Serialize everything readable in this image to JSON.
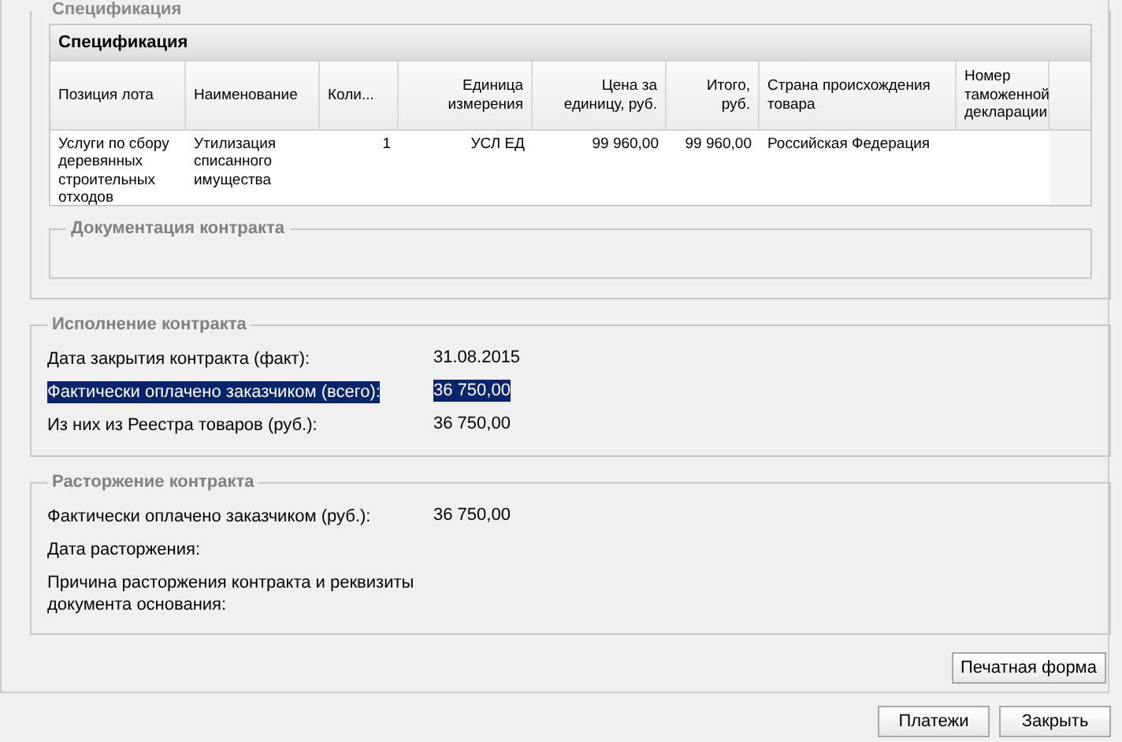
{
  "specification": {
    "legend": "Спецификация",
    "grid_title": "Спецификация",
    "columns": [
      "Позиция лота",
      "Наименование",
      "Коли...",
      "Единица измерения",
      "Цена за единицу, руб.",
      "Итого, руб.",
      "Страна происхождения товара",
      "Номер таможенной декларации"
    ],
    "rows": [
      [
        "Услуги по сбору деревянных строительных отходов",
        "Утилизация списанного имущества",
        "1",
        "УСЛ ЕД",
        "99 960,00",
        "99 960,00",
        "Российская Федерация",
        ""
      ]
    ]
  },
  "documentation": {
    "legend": "Документация контракта"
  },
  "execution": {
    "legend": "Исполнение контракта",
    "fields": [
      {
        "label": "Дата закрытия контракта (факт):",
        "value": "31.08.2015",
        "selected": false
      },
      {
        "label": "Фактически оплачено заказчиком (всего):",
        "value": "36 750,00",
        "selected": true
      },
      {
        "label": "Из них из Реестра товаров (руб.):",
        "value": "36 750,00",
        "selected": false
      }
    ]
  },
  "termination": {
    "legend": "Расторжение контракта",
    "fields": [
      {
        "label": "Фактически оплачено заказчиком (руб.):",
        "value": "36 750,00",
        "selected": false
      },
      {
        "label": "Дата расторжения:",
        "selected": false
      },
      {
        "label": "Причина расторжения контракта и реквизиты документа основания:",
        "selected": false
      }
    ]
  },
  "print_button": "Печатная форма",
  "buttons": [
    "Платежи",
    "Закрыть"
  ]
}
